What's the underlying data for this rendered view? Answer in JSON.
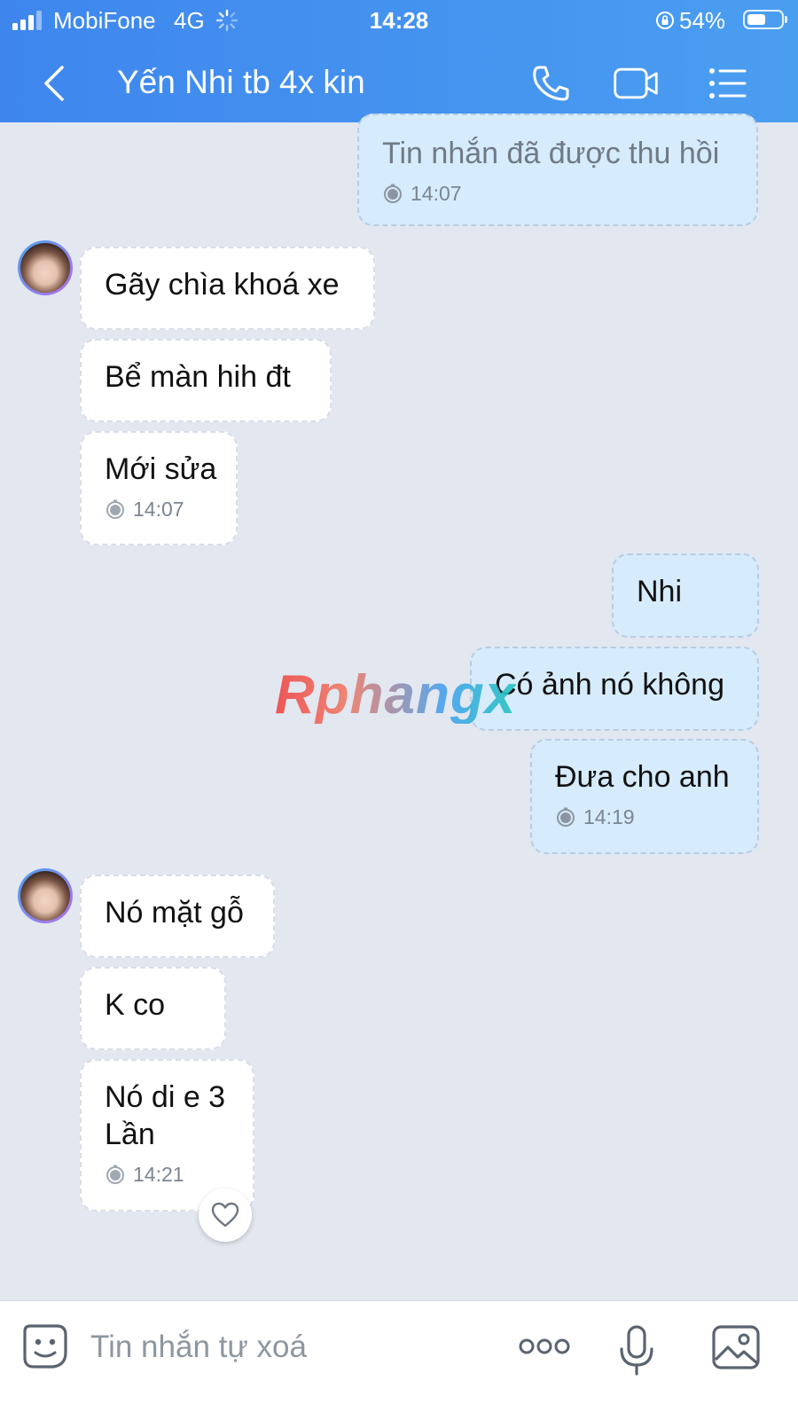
{
  "status_bar": {
    "carrier": "MobiFone",
    "network": "4G",
    "time": "14:28",
    "battery": "54%"
  },
  "header": {
    "title": "Yến Nhi tb 4x kin"
  },
  "messages": [
    {
      "direction": "out",
      "text": "Tin nhắn đã được thu hồi",
      "time": "14:07"
    },
    {
      "direction": "in",
      "text": "Gãy chìa khoá xe"
    },
    {
      "direction": "in",
      "text": "Bể màn hih đt"
    },
    {
      "direction": "in",
      "text": "Mới sửa",
      "time": "14:07"
    },
    {
      "direction": "out",
      "text": "Nhi"
    },
    {
      "direction": "out",
      "text": "Có ảnh nó không"
    },
    {
      "direction": "out",
      "text": "Đưa cho anh",
      "time": "14:19"
    },
    {
      "direction": "in",
      "text": "Nó mặt gỗ"
    },
    {
      "direction": "in",
      "text": "K co"
    },
    {
      "direction": "in",
      "text": "Nó di e 3 Lần",
      "time": "14:21"
    }
  ],
  "watermark": "Rphangx",
  "composer": {
    "placeholder": "Tin nhắn tự xoá"
  },
  "icons": {
    "back": "chevron-left-icon",
    "call": "phone-icon",
    "video": "video-camera-icon",
    "menu": "list-menu-icon",
    "emoji": "emoji-sticker-icon",
    "more": "more-dots-icon",
    "mic": "microphone-icon",
    "gallery": "image-gallery-icon",
    "reaction": "heart-icon"
  },
  "colors": {
    "header_start": "#3e86ee",
    "header_end": "#4a9ef0",
    "chat_background": "#e2e7f0",
    "outgoing_bubble": "#d6ebfb",
    "incoming_bubble": "#ffffff"
  }
}
